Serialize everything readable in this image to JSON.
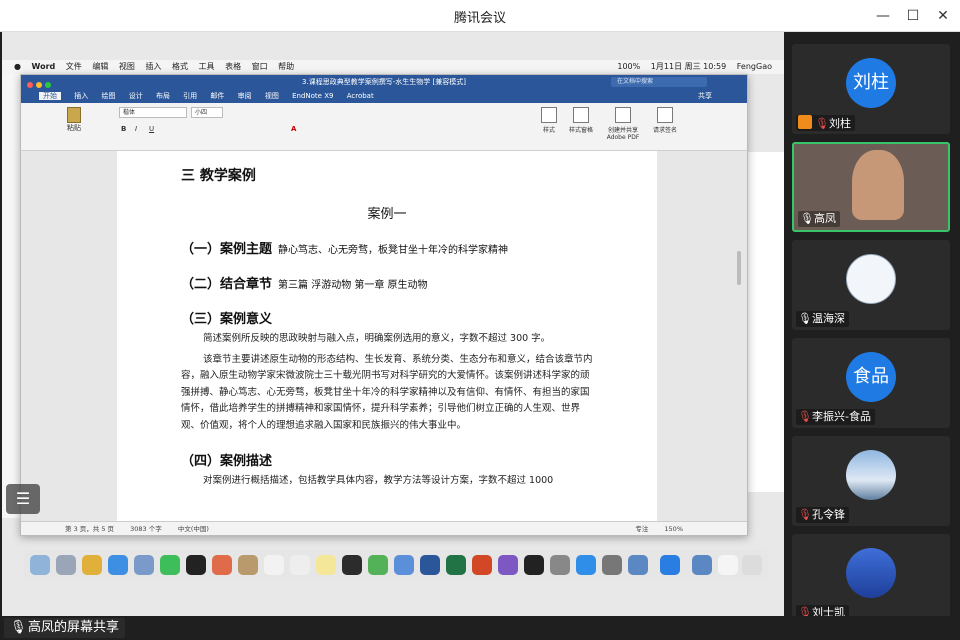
{
  "window": {
    "title": "腾讯会议",
    "minimize": "—",
    "maximize": "☐",
    "close": "✕"
  },
  "share_label": "高凤的屏幕共享",
  "mac_menubar": {
    "items": [
      "Word",
      "文件",
      "编辑",
      "视图",
      "插入",
      "格式",
      "工具",
      "表格",
      "窗口",
      "帮助"
    ],
    "status_right": [
      "100%",
      "1月11日 周三 10:59",
      "FengGao"
    ]
  },
  "word": {
    "doc_title": "3.课程思政典型教学案例撰写-水生生物学 [兼容模式]",
    "search_placeholder": "在文档中搜索",
    "tabs": [
      "开始",
      "插入",
      "绘图",
      "设计",
      "布局",
      "引用",
      "邮件",
      "审阅",
      "视图",
      "EndNote X9",
      "Acrobat"
    ],
    "share_button": "共享",
    "font_name": "楷体",
    "font_size": "小四",
    "paste_label": "粘贴",
    "style_label": "样式",
    "styles_pane_label": "样式窗格",
    "create_pdf_label": "创建并共享 Adobe PDF",
    "request_sign_label": "请求签名",
    "status": {
      "page": "第 3 页，共 5 页",
      "words": "3083 个字",
      "lang": "中文(中国)",
      "focus": "专注",
      "zoom": "150%"
    }
  },
  "document": {
    "section_heading": "三 教学案例",
    "case_title": "案例一",
    "s1_heading": "（一）案例主题",
    "s1_text": "静心笃志、心无旁骛，板凳甘坐十年冷的科学家精神",
    "s2_heading": "（二）结合章节",
    "s2_text": "第三篇 浮游动物 第一章 原生动物",
    "s3_heading": "（三）案例意义",
    "s3_p1": "简述案例所反映的思政映射与融入点，明确案例选用的意义，字数不超过 300 字。",
    "s3_p2": "该章节主要讲述原生动物的形态结构、生长发育、系统分类、生态分布和意义，结合该章节内容，融入原生动物学家宋微波院士三十载光阴书写对科学研究的大爱情怀。该案例讲述科学家的顽强拼搏、静心笃志、心无旁骛，板凳甘坐十年冷的科学家精神以及有信仰、有情怀、有担当的家国情怀，借此培养学生的拼搏精神和家国情怀，提升科学素养；引导他们树立正确的人生观、世界观、价值观，将个人的理想追求融入国家和民族振兴的伟大事业中。",
    "s4_heading": "（四）案例描述",
    "s4_p1": "对案例进行概括描述，包括教学具体内容，教学方法等设计方案，字数不超过 1000"
  },
  "participants": [
    {
      "name": "刘柱",
      "avatar_text": "刘柱",
      "muted": true,
      "host": true
    },
    {
      "name": "高凤",
      "muted": false,
      "video": true
    },
    {
      "name": "温海深",
      "muted": false
    },
    {
      "name": "李振兴-食品",
      "avatar_text": "食品",
      "muted": true
    },
    {
      "name": "孔令锋",
      "muted": true
    },
    {
      "name": "刘士凯",
      "muted": true
    }
  ],
  "colors": {
    "word_blue": "#2b579a",
    "avatar_blue": "#1f7be3",
    "active_border": "#38c56a",
    "muted_red": "#e84c4c"
  }
}
